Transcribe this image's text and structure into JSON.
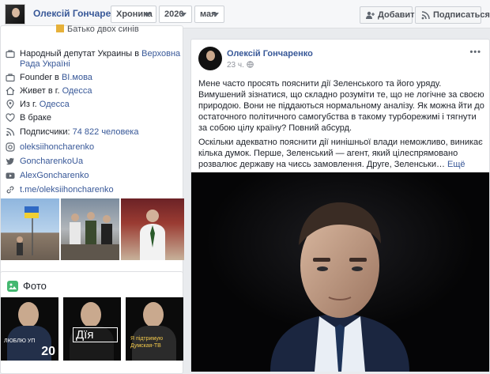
{
  "header": {
    "name": "Олексій Гончаренко",
    "timeline_tab": "Хроника",
    "year": "2020",
    "month": "мая",
    "add_button": "Добавить",
    "subscribe_button": "Подписаться"
  },
  "about": {
    "partial_line": "Батько двох синів",
    "deputy_prefix": "Народный депутат Украины в ",
    "deputy_link": "Верховна Рада Україні",
    "founder_prefix": "Founder в ",
    "founder_link": "ВІ.мова",
    "lives_prefix": "Живет в г. ",
    "lives_link": "Одесса",
    "from_prefix": "Из г. ",
    "from_link": "Одесса",
    "marital": "В браке",
    "followers_prefix": "Подписчики: ",
    "followers_link": "74 822 человека",
    "instagram": "oleksiihoncharenko",
    "twitter": "GoncharenkoUa",
    "youtube": "AlexGoncharenko",
    "telegram": "t.me/oleksiihoncharenko"
  },
  "photos": {
    "title": "Фото",
    "thumb1_small": "ЛЮБЛЮ УП",
    "thumb1_big": "20",
    "thumb2": "Дїя",
    "thumb3": "Я підтримую Думская-ТВ"
  },
  "post": {
    "author": "Олексій Гончаренко",
    "time": "23 ч.",
    "paragraph1": "Мене часто просять пояснити дії Зеленського та його уряду. Вимушений зізнатися, що складно розуміти те, що не логічне за своєю природою. Вони не піддаються нормальному аналізу. Як можна йти до остаточного політичного самогубства в такому турборежимі і тягнути за собою цілу країну? Повний абсурд.",
    "paragraph2": "Оскільки адекватно пояснити дії нинішньої влади неможливо, виникає кілька думок. Перше, Зеленський — агент, який цілеспрямовано розвалює державу на чиєсь замовлення. Друге, Зеленськи…",
    "more": "Ещё"
  },
  "colors": {
    "link": "#385898",
    "bg": "#e9ebee",
    "photo_icon": "#44b870"
  }
}
